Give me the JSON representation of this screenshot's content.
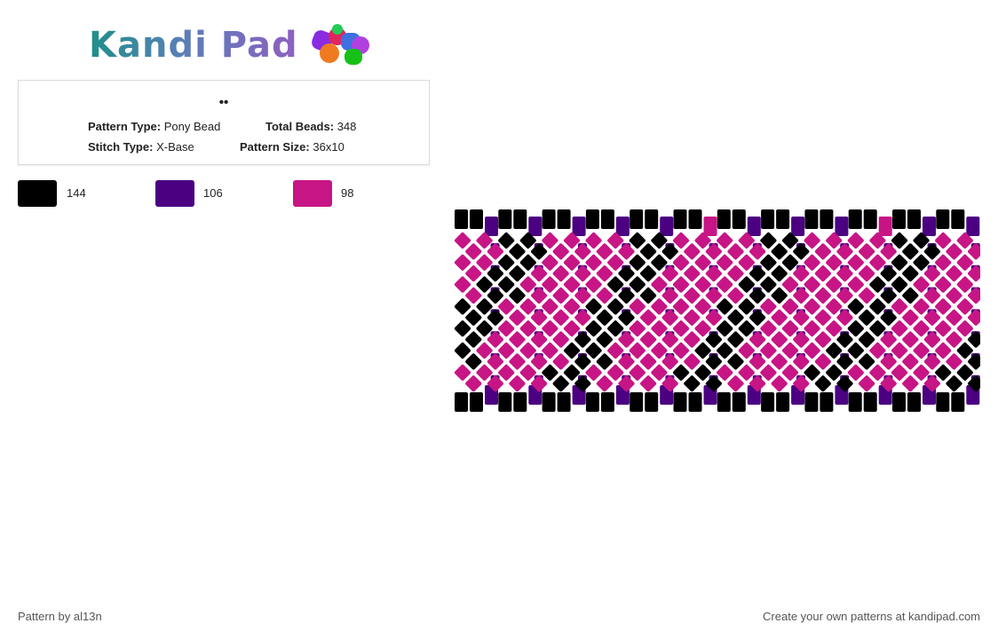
{
  "brand": {
    "logo_text": "Kandi Pad"
  },
  "pattern": {
    "title": "••",
    "type_label": "Pattern Type:",
    "type_value": "Pony Bead",
    "total_label": "Total Beads:",
    "total_value": "348",
    "stitch_label": "Stitch Type:",
    "stitch_value": "X-Base",
    "size_label": "Pattern Size:",
    "size_value": "36x10"
  },
  "colors": {
    "black": "#000000",
    "purple": "#4b0082",
    "pink": "#c71585",
    "accent_teal": "#1f8f8a",
    "accent_violet": "#8e5fc2"
  },
  "palette": [
    {
      "color": "#000000",
      "count": "144"
    },
    {
      "color": "#4b0082",
      "count": "106"
    },
    {
      "color": "#c71585",
      "count": "98"
    }
  ],
  "footer": {
    "author": "Pattern by al13n",
    "promo": "Create your own patterns at kandipad.com"
  }
}
